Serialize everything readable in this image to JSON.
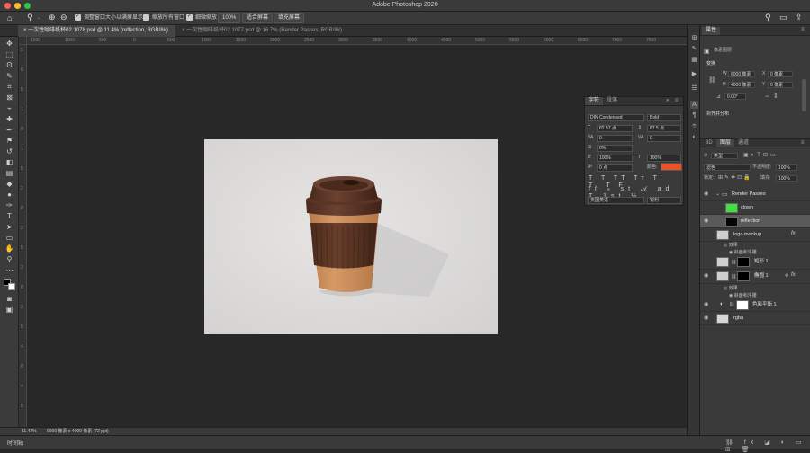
{
  "app": {
    "title": "Adobe Photoshop 2020"
  },
  "options": {
    "resize_windows_label": "调整窗口大小以满屏显示",
    "zoom_all_label": "缩放所有窗口",
    "scrubby_zoom_label": "细微缩放",
    "zoom_pct_button": "100%",
    "fit_screen_button": "适合屏幕",
    "fill_screen_button": "填充屏幕"
  },
  "tabs": [
    {
      "label": "一次性咖啡纸杯02.1078.psd @ 11.4% (reflection, RGB/8#) *"
    },
    {
      "label": "一次性咖啡纸杯02.1077.psd @ 16.7% (Render Passes, RGB/8#)"
    }
  ],
  "ruler_h_ticks": [
    "1500",
    "1000",
    "500",
    "0",
    "500",
    "1000",
    "1500",
    "2000",
    "2500",
    "3000",
    "3500",
    "4000",
    "4500",
    "5000",
    "5500",
    "6000",
    "6500",
    "7000",
    "7500"
  ],
  "ruler_v_ticks": [
    "5",
    "0",
    "5",
    "1",
    "0",
    "1",
    "5",
    "2",
    "0",
    "2",
    "5",
    "3",
    "0",
    "3",
    "5",
    "4",
    "0",
    "4",
    "5"
  ],
  "status": {
    "zoom": "11.42%",
    "doc_info": "6000 像素 x 4000 像素 (72 ppi)"
  },
  "timeline": {
    "label": "时间轴"
  },
  "properties": {
    "tab": "属性",
    "section_doc": "像素图层",
    "section_transform": "变换",
    "w_label": "W",
    "w_value": "6000 像素",
    "x_label": "X",
    "x_value": "0 像素",
    "h_label": "H",
    "h_value": "4000 像素",
    "y_label": "Y",
    "y_value": "0 像素",
    "angle_value": "0.00°",
    "section_align": "对齐并分布"
  },
  "layers_panel": {
    "tabs": [
      "3D",
      "图层",
      "通道"
    ],
    "filter_label": "类型",
    "blend_mode": "滤色",
    "opacity_label": "不透明度:",
    "opacity_value": "100%",
    "lock_label": "锁定:",
    "fill_label": "填充:",
    "fill_value": "100%",
    "layers": [
      {
        "name": "Render Passes"
      },
      {
        "name": "clown"
      },
      {
        "name": "reflection"
      },
      {
        "name": "logo mockup",
        "fx": "fx"
      },
      {
        "name": "效果"
      },
      {
        "name": "斜面和浮雕"
      },
      {
        "name": "矩形 1"
      },
      {
        "name": "椭圆 1",
        "fx": "fx"
      },
      {
        "name": "效果"
      },
      {
        "name": "斜面和浮雕"
      },
      {
        "name": "色彩平衡 1"
      },
      {
        "name": "rgba"
      }
    ]
  },
  "character": {
    "tabs": [
      "字符",
      "段落"
    ],
    "font": "DIN Condensed",
    "style": "Bold",
    "size": "82.57 点",
    "leading": "87.5 点",
    "kerning": "0",
    "tracking": "0",
    "vscale_label": "0%",
    "hscale": "100%",
    "vscale": "100%",
    "baseline": "0 点",
    "color_label": "颜色:",
    "color": "#e8532a",
    "language": "美国英语",
    "aa": "锐利"
  },
  "colors": {
    "accent": "#2d8ceb",
    "layer_clown_thumb": "#3fe13f",
    "char_color": "#e8532a"
  }
}
